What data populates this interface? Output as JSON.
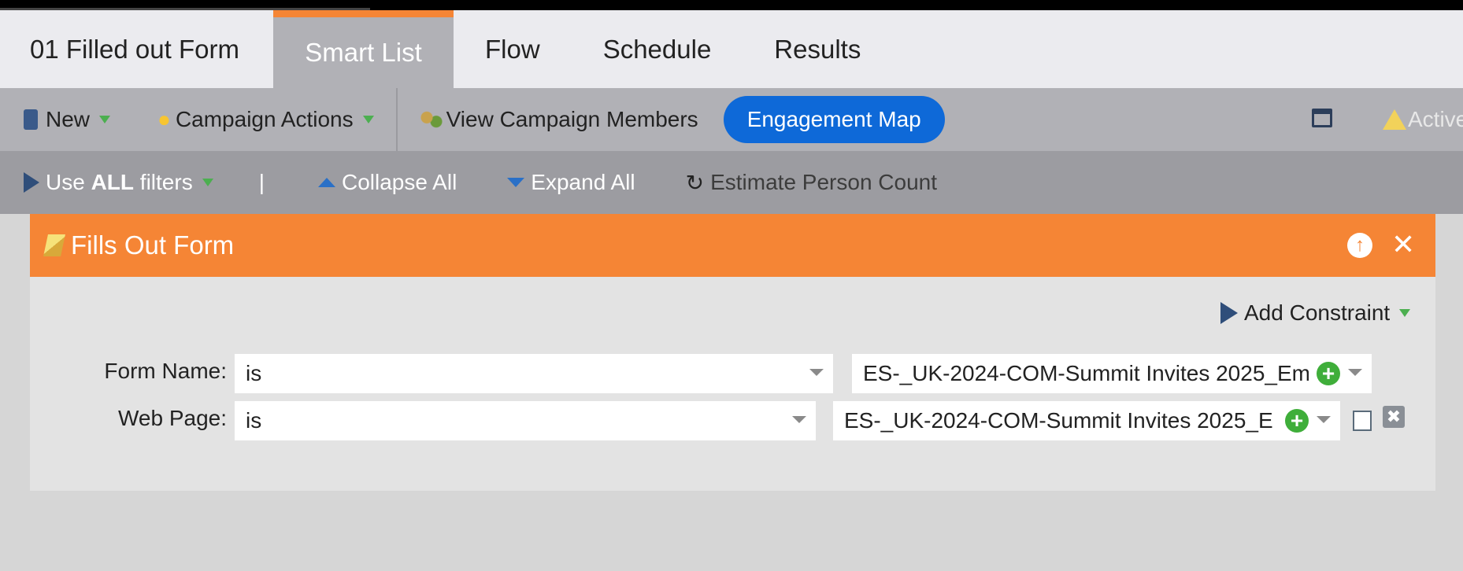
{
  "tabs": [
    {
      "label": "01 Filled out Form"
    },
    {
      "label": "Smart List"
    },
    {
      "label": "Flow"
    },
    {
      "label": "Schedule"
    },
    {
      "label": "Results"
    }
  ],
  "toolbar": {
    "new_label": "New",
    "campaign_actions_label": "Campaign Actions",
    "view_members_label": "View Campaign Members",
    "engagement_map_label": "Engagement Map",
    "active_label": "Active"
  },
  "filterbar": {
    "use_prefix": "Use ",
    "use_bold": "ALL",
    "use_suffix": " filters",
    "pipe": "|",
    "collapse_label": "Collapse All",
    "expand_label": "Expand All",
    "estimate_label": "Estimate Person Count"
  },
  "filter": {
    "title": "Fills Out Form",
    "add_constraint_label": "Add Constraint",
    "rows": [
      {
        "label": "Form Name:",
        "operator": "is",
        "value": "ES-_UK-2024-COM-Summit Invites 2025_Em"
      },
      {
        "label": "Web Page:",
        "operator": "is",
        "value": "ES-_UK-2024-COM-Summit Invites 2025_E"
      }
    ]
  },
  "colors": {
    "accent_orange": "#f58535",
    "pill_blue": "#0e69d8",
    "green": "#4caf50"
  }
}
